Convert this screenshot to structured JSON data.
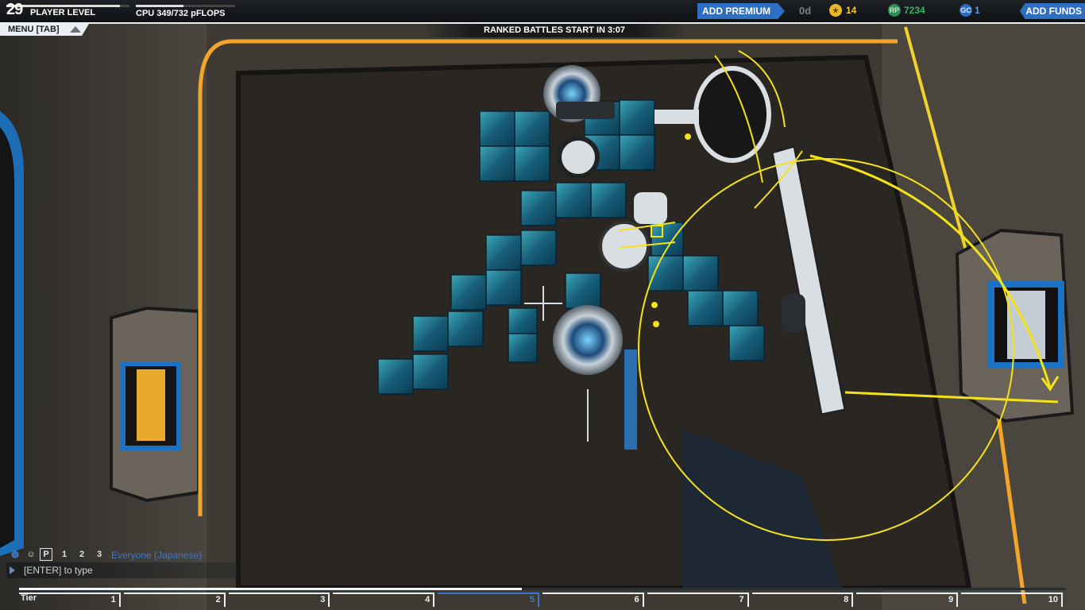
{
  "player": {
    "level": "29",
    "level_label": "PLAYER LEVEL",
    "level_progress": 0.92
  },
  "cpu": {
    "label": "CPU 349/732 pFLOPS",
    "used": 349,
    "max": 732
  },
  "premium": {
    "button_label": "ADD PREMIUM",
    "days": "0d"
  },
  "currencies": {
    "stars": {
      "icon": "star-icon",
      "value": "14"
    },
    "robits": {
      "icon": "rp-coin-icon",
      "icon_text": "RP",
      "value": "7234"
    },
    "galaxy_credits": {
      "icon": "gc-coin-icon",
      "icon_text": "GC",
      "value": "1"
    }
  },
  "funds": {
    "button_label": "ADD FUNDS"
  },
  "menu": {
    "label": "MENU [TAB]"
  },
  "banner": {
    "ranked_text": "RANKED BATTLES START IN 3:07"
  },
  "chat": {
    "channel_icons": [
      {
        "name": "globe-icon",
        "glyph": "◍"
      },
      {
        "name": "person-icon",
        "glyph": "☺"
      },
      {
        "name": "party-icon",
        "glyph": "P"
      },
      {
        "name": "user-1-icon",
        "glyph": "1"
      },
      {
        "name": "user-2-icon",
        "glyph": "2"
      },
      {
        "name": "user-3-icon",
        "glyph": "3"
      }
    ],
    "channel_label": "Everyone (Japanese)",
    "placeholder": "[ENTER] to type"
  },
  "tiers": {
    "label": "Tier",
    "items": [
      "1",
      "2",
      "3",
      "4",
      "5",
      "6",
      "7",
      "8",
      "9",
      "10"
    ],
    "current": "5",
    "progress": 0.48
  },
  "colors": {
    "accent_blue": "#2e6fc4",
    "guide_yellow": "#f4e21a",
    "star_gold": "#e8b92a",
    "rp_green": "#2f8c55",
    "gc_blue": "#2c6dbf"
  }
}
